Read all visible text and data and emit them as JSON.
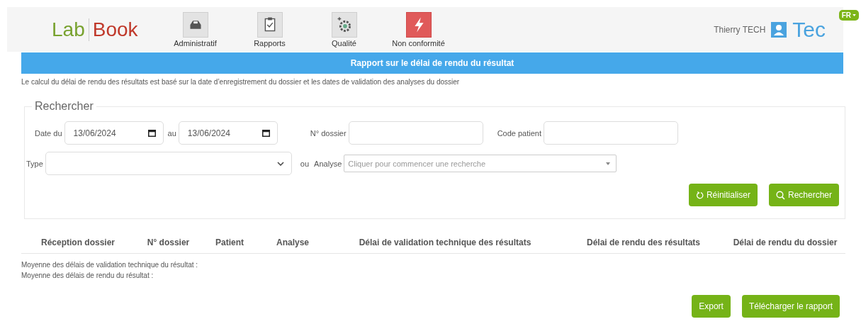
{
  "header": {
    "logo": {
      "left": "Lab",
      "right": "Book"
    },
    "nav": [
      {
        "label": "Administratif",
        "kind": "inbox"
      },
      {
        "label": "Rapports",
        "kind": "clipboard"
      },
      {
        "label": "Qualité",
        "kind": "gear"
      },
      {
        "label": "Non conformité",
        "kind": "bolt"
      }
    ],
    "user": "Thierry TECH",
    "brand": "Tec",
    "language": "FR"
  },
  "title": "Rapport sur le délai de rendu du résultat",
  "description": "Le calcul du délai de rendu des résultats est basé sur la date d’enregistrement du dossier et les dates de validation des analyses du dossier",
  "search": {
    "legend": "Rechercher",
    "row_1": [
      {
        "label": "Date du",
        "kind": "date",
        "value": "13/06/2024"
      },
      {
        "label": "au",
        "kind": "date",
        "value": "13/06/2024"
      },
      {
        "label": "N° dossier",
        "kind": "text"
      },
      {
        "label": "Code patient",
        "kind": "text"
      }
    ],
    "row_2": [
      {
        "label": "Type",
        "kind": "select"
      },
      {
        "label": "ou",
        "kind": "word"
      },
      {
        "label": "Analyse",
        "kind": "combo",
        "placeholder": "Cliquer pour commencer une recherche"
      }
    ],
    "buttons": [
      {
        "label": "Réinitialiser",
        "kind": "reset"
      },
      {
        "label": "Rechercher",
        "kind": "search"
      }
    ]
  },
  "table": {
    "columns": [
      "Réception dossier",
      "N° dossier",
      "Patient",
      "Analyse",
      "Délai de validation technique des résultats",
      "Délai de rendu des résultats",
      "Délai de rendu du dossier"
    ]
  },
  "summary": [
    "Moyenne des délais de validation technique du résultat :",
    "Moyenne des délais de rendu du résultat :"
  ],
  "actions": [
    "Export",
    "Télécharger le rapport"
  ]
}
